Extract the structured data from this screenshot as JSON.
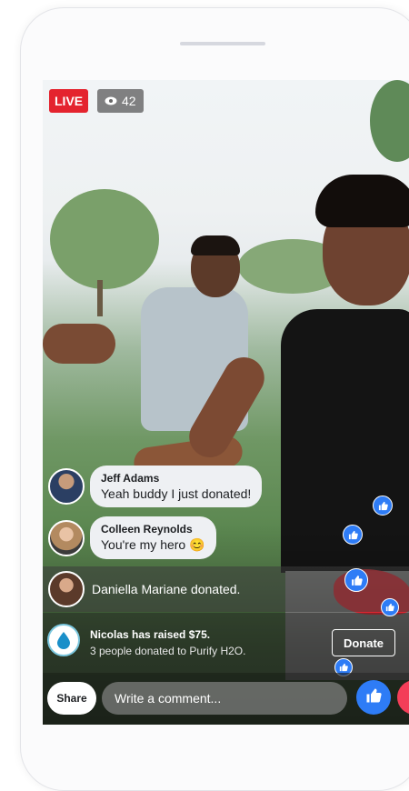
{
  "stream": {
    "live_label": "LIVE",
    "viewer_count": "42",
    "comments": [
      {
        "name": "Jeff Adams",
        "message": "Yeah buddy I just donated!"
      },
      {
        "name": "Colleen Reynolds",
        "message": "You're my hero 😊"
      }
    ],
    "donation_notice": "Daniella Mariane donated.",
    "fundraiser": {
      "headline": "Nicolas has raised $75.",
      "subline": "3 people donated to Purify H2O.",
      "donate_label": "Donate"
    },
    "share_label": "Share",
    "comment_placeholder": "Write a comment..."
  },
  "colors": {
    "live_red": "#e4232e",
    "like_blue": "#2e7cf6",
    "love_red": "#f33e58"
  }
}
